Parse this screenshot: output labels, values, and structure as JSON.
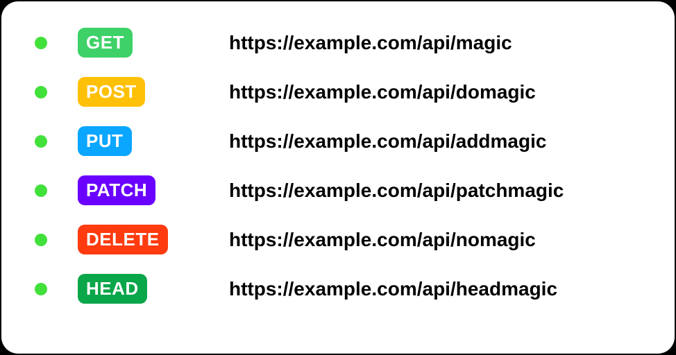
{
  "colors": {
    "status_dot": "#42e03b",
    "get": "#3dd168",
    "post": "#ffc107",
    "put": "#0aa6ff",
    "patch": "#6a00ff",
    "delete": "#ff3b0f",
    "head": "#0aa64a"
  },
  "endpoints": [
    {
      "method": "GET",
      "url": "https://example.com/api/magic",
      "color_key": "get"
    },
    {
      "method": "POST",
      "url": "https://example.com/api/domagic",
      "color_key": "post"
    },
    {
      "method": "PUT",
      "url": "https://example.com/api/addmagic",
      "color_key": "put"
    },
    {
      "method": "PATCH",
      "url": "https://example.com/api/patchmagic",
      "color_key": "patch"
    },
    {
      "method": "DELETE",
      "url": "https://example.com/api/nomagic",
      "color_key": "delete"
    },
    {
      "method": "HEAD",
      "url": "https://example.com/api/headmagic",
      "color_key": "head"
    }
  ]
}
